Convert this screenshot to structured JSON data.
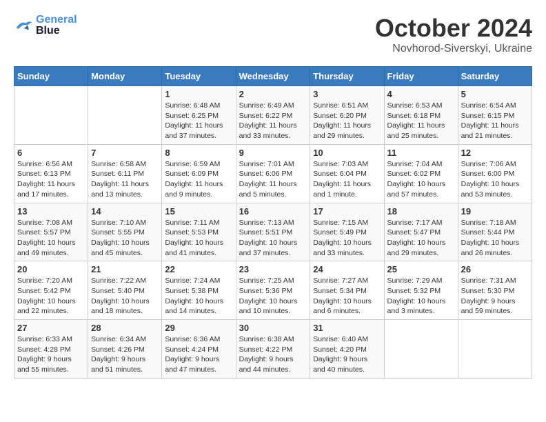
{
  "logo": {
    "text1": "General",
    "text2": "Blue"
  },
  "title": "October 2024",
  "subtitle": "Novhorod-Siverskyi, Ukraine",
  "days_of_week": [
    "Sunday",
    "Monday",
    "Tuesday",
    "Wednesday",
    "Thursday",
    "Friday",
    "Saturday"
  ],
  "weeks": [
    [
      {
        "day": "",
        "info": ""
      },
      {
        "day": "",
        "info": ""
      },
      {
        "day": "1",
        "info": "Sunrise: 6:48 AM\nSunset: 6:25 PM\nDaylight: 11 hours and 37 minutes."
      },
      {
        "day": "2",
        "info": "Sunrise: 6:49 AM\nSunset: 6:22 PM\nDaylight: 11 hours and 33 minutes."
      },
      {
        "day": "3",
        "info": "Sunrise: 6:51 AM\nSunset: 6:20 PM\nDaylight: 11 hours and 29 minutes."
      },
      {
        "day": "4",
        "info": "Sunrise: 6:53 AM\nSunset: 6:18 PM\nDaylight: 11 hours and 25 minutes."
      },
      {
        "day": "5",
        "info": "Sunrise: 6:54 AM\nSunset: 6:15 PM\nDaylight: 11 hours and 21 minutes."
      }
    ],
    [
      {
        "day": "6",
        "info": "Sunrise: 6:56 AM\nSunset: 6:13 PM\nDaylight: 11 hours and 17 minutes."
      },
      {
        "day": "7",
        "info": "Sunrise: 6:58 AM\nSunset: 6:11 PM\nDaylight: 11 hours and 13 minutes."
      },
      {
        "day": "8",
        "info": "Sunrise: 6:59 AM\nSunset: 6:09 PM\nDaylight: 11 hours and 9 minutes."
      },
      {
        "day": "9",
        "info": "Sunrise: 7:01 AM\nSunset: 6:06 PM\nDaylight: 11 hours and 5 minutes."
      },
      {
        "day": "10",
        "info": "Sunrise: 7:03 AM\nSunset: 6:04 PM\nDaylight: 11 hours and 1 minute."
      },
      {
        "day": "11",
        "info": "Sunrise: 7:04 AM\nSunset: 6:02 PM\nDaylight: 10 hours and 57 minutes."
      },
      {
        "day": "12",
        "info": "Sunrise: 7:06 AM\nSunset: 6:00 PM\nDaylight: 10 hours and 53 minutes."
      }
    ],
    [
      {
        "day": "13",
        "info": "Sunrise: 7:08 AM\nSunset: 5:57 PM\nDaylight: 10 hours and 49 minutes."
      },
      {
        "day": "14",
        "info": "Sunrise: 7:10 AM\nSunset: 5:55 PM\nDaylight: 10 hours and 45 minutes."
      },
      {
        "day": "15",
        "info": "Sunrise: 7:11 AM\nSunset: 5:53 PM\nDaylight: 10 hours and 41 minutes."
      },
      {
        "day": "16",
        "info": "Sunrise: 7:13 AM\nSunset: 5:51 PM\nDaylight: 10 hours and 37 minutes."
      },
      {
        "day": "17",
        "info": "Sunrise: 7:15 AM\nSunset: 5:49 PM\nDaylight: 10 hours and 33 minutes."
      },
      {
        "day": "18",
        "info": "Sunrise: 7:17 AM\nSunset: 5:47 PM\nDaylight: 10 hours and 29 minutes."
      },
      {
        "day": "19",
        "info": "Sunrise: 7:18 AM\nSunset: 5:44 PM\nDaylight: 10 hours and 26 minutes."
      }
    ],
    [
      {
        "day": "20",
        "info": "Sunrise: 7:20 AM\nSunset: 5:42 PM\nDaylight: 10 hours and 22 minutes."
      },
      {
        "day": "21",
        "info": "Sunrise: 7:22 AM\nSunset: 5:40 PM\nDaylight: 10 hours and 18 minutes."
      },
      {
        "day": "22",
        "info": "Sunrise: 7:24 AM\nSunset: 5:38 PM\nDaylight: 10 hours and 14 minutes."
      },
      {
        "day": "23",
        "info": "Sunrise: 7:25 AM\nSunset: 5:36 PM\nDaylight: 10 hours and 10 minutes."
      },
      {
        "day": "24",
        "info": "Sunrise: 7:27 AM\nSunset: 5:34 PM\nDaylight: 10 hours and 6 minutes."
      },
      {
        "day": "25",
        "info": "Sunrise: 7:29 AM\nSunset: 5:32 PM\nDaylight: 10 hours and 3 minutes."
      },
      {
        "day": "26",
        "info": "Sunrise: 7:31 AM\nSunset: 5:30 PM\nDaylight: 9 hours and 59 minutes."
      }
    ],
    [
      {
        "day": "27",
        "info": "Sunrise: 6:33 AM\nSunset: 4:28 PM\nDaylight: 9 hours and 55 minutes."
      },
      {
        "day": "28",
        "info": "Sunrise: 6:34 AM\nSunset: 4:26 PM\nDaylight: 9 hours and 51 minutes."
      },
      {
        "day": "29",
        "info": "Sunrise: 6:36 AM\nSunset: 4:24 PM\nDaylight: 9 hours and 47 minutes."
      },
      {
        "day": "30",
        "info": "Sunrise: 6:38 AM\nSunset: 4:22 PM\nDaylight: 9 hours and 44 minutes."
      },
      {
        "day": "31",
        "info": "Sunrise: 6:40 AM\nSunset: 4:20 PM\nDaylight: 9 hours and 40 minutes."
      },
      {
        "day": "",
        "info": ""
      },
      {
        "day": "",
        "info": ""
      }
    ]
  ]
}
